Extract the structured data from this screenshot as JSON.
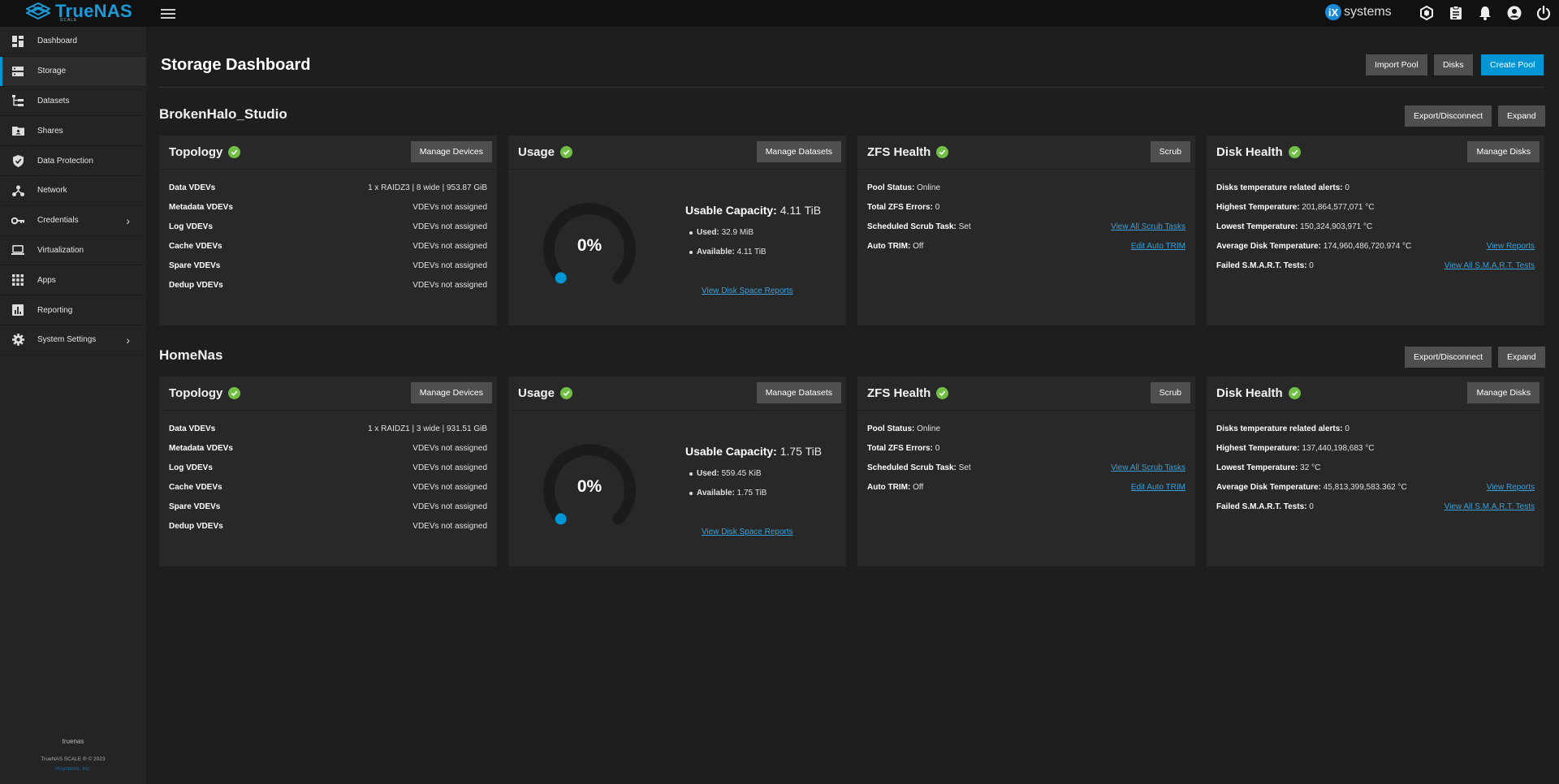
{
  "app": {
    "logo": "TrueNAS",
    "logo_sub": "SCALE",
    "vendor": "systems",
    "vendor_badge": "iX"
  },
  "colors": {
    "accent": "#0095d5",
    "healthy": "#71bf44",
    "link": "#3a9fd8"
  },
  "topbar_icons": [
    "truecommand-icon",
    "clipboard-icon",
    "bell-icon",
    "account-icon",
    "power-icon"
  ],
  "sidebar": {
    "items": [
      {
        "label": "Dashboard",
        "icon": "dashboard-icon"
      },
      {
        "label": "Storage",
        "icon": "storage-icon",
        "active": true
      },
      {
        "label": "Datasets",
        "icon": "datasets-icon"
      },
      {
        "label": "Shares",
        "icon": "shares-icon"
      },
      {
        "label": "Data Protection",
        "icon": "shield-icon"
      },
      {
        "label": "Network",
        "icon": "network-icon"
      },
      {
        "label": "Credentials",
        "icon": "key-icon",
        "submenu": true
      },
      {
        "label": "Virtualization",
        "icon": "laptop-icon"
      },
      {
        "label": "Apps",
        "icon": "apps-icon"
      },
      {
        "label": "Reporting",
        "icon": "reporting-icon"
      },
      {
        "label": "System Settings",
        "icon": "gear-icon",
        "submenu": true
      }
    ],
    "hostname": "truenas",
    "copyright": "TrueNAS SCALE ® © 2023",
    "company": "iXsystems, Inc."
  },
  "page": {
    "title": "Storage Dashboard",
    "import_pool": "Import Pool",
    "disks": "Disks",
    "create_pool": "Create Pool"
  },
  "labels": {
    "export": "Export/Disconnect",
    "expand": "Expand",
    "topology": "Topology",
    "manage_devices": "Manage Devices",
    "usage": "Usage",
    "manage_datasets": "Manage Datasets",
    "zfs_health": "ZFS Health",
    "scrub": "Scrub",
    "disk_health": "Disk Health",
    "manage_disks": "Manage Disks",
    "data_vdevs": "Data VDEVs",
    "metadata_vdevs": "Metadata VDEVs",
    "log_vdevs": "Log VDEVs",
    "cache_vdevs": "Cache VDEVs",
    "spare_vdevs": "Spare VDEVs",
    "dedup_vdevs": "Dedup VDEVs",
    "usable_capacity": "Usable Capacity:",
    "used": "Used:",
    "available": "Available:",
    "view_disk_space": "View Disk Space Reports",
    "pool_status": "Pool Status:",
    "total_errors": "Total ZFS Errors:",
    "scrub_task": "Scheduled Scrub Task:",
    "auto_trim": "Auto TRIM:",
    "view_scrub": "View All Scrub Tasks",
    "edit_trim": "Edit Auto TRIM",
    "temp_alerts": "Disks temperature related alerts:",
    "highest_temp": "Highest Temperature:",
    "lowest_temp": "Lowest Temperature:",
    "avg_temp": "Average Disk Temperature:",
    "failed_smart": "Failed S.M.A.R.T. Tests:",
    "view_reports": "View Reports",
    "view_smart": "View All S.M.A.R.T. Tests"
  },
  "pools": [
    {
      "name": "BrokenHalo_Studio",
      "topology": {
        "data": "1 x RAIDZ3 | 8 wide | 953.87 GiB",
        "metadata": "VDEVs not assigned",
        "log": "VDEVs not assigned",
        "cache": "VDEVs not assigned",
        "spare": "VDEVs not assigned",
        "dedup": "VDEVs not assigned"
      },
      "usage": {
        "percent": "0%",
        "capacity": "4.11 TiB",
        "used": "32.9 MiB",
        "available": "4.11 TiB"
      },
      "zfs": {
        "status": "Online",
        "errors": "0",
        "scrub_task": "Set",
        "auto_trim": "Off"
      },
      "disks": {
        "alerts": "0",
        "highest": "201,864,577,071 °C",
        "lowest": "150,324,903,971 °C",
        "average": "174,960,486,720.974 °C",
        "failed": "0"
      }
    },
    {
      "name": "HomeNas",
      "topology": {
        "data": "1 x RAIDZ1 | 3 wide | 931.51 GiB",
        "metadata": "VDEVs not assigned",
        "log": "VDEVs not assigned",
        "cache": "VDEVs not assigned",
        "spare": "VDEVs not assigned",
        "dedup": "VDEVs not assigned"
      },
      "usage": {
        "percent": "0%",
        "capacity": "1.75 TiB",
        "used": "559.45 KiB",
        "available": "1.75 TiB"
      },
      "zfs": {
        "status": "Online",
        "errors": "0",
        "scrub_task": "Set",
        "auto_trim": "Off"
      },
      "disks": {
        "alerts": "0",
        "highest": "137,440,198,683 °C",
        "lowest": "32 °C",
        "average": "45,813,399,583.362 °C",
        "failed": "0"
      }
    }
  ]
}
